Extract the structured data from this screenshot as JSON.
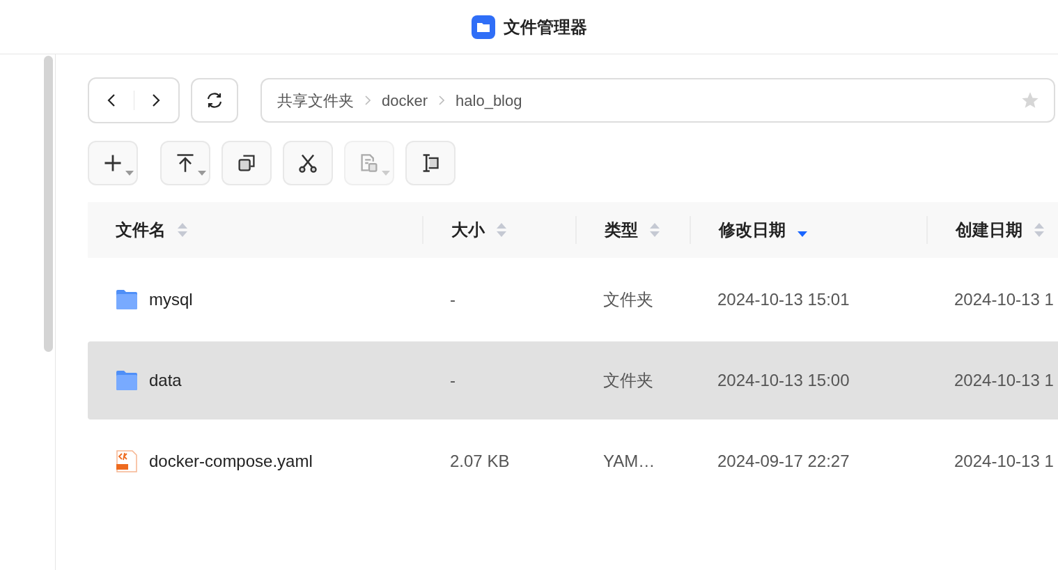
{
  "window": {
    "title": "文件管理器"
  },
  "breadcrumb": [
    "共享文件夹",
    "docker",
    "halo_blog"
  ],
  "favorite": {
    "on": false
  },
  "toolbar": [
    {
      "kind": "new",
      "dropdown": true,
      "disabled": false
    },
    {
      "kind": "upload",
      "dropdown": true,
      "disabled": false
    },
    {
      "kind": "copy",
      "dropdown": false,
      "disabled": false
    },
    {
      "kind": "cut",
      "dropdown": false,
      "disabled": false
    },
    {
      "kind": "paste",
      "dropdown": true,
      "disabled": true
    },
    {
      "kind": "rename",
      "dropdown": false,
      "disabled": false
    }
  ],
  "table": {
    "columns": [
      {
        "label": "文件名",
        "sorted": false
      },
      {
        "label": "大小",
        "sorted": false
      },
      {
        "label": "类型",
        "sorted": false
      },
      {
        "label": "修改日期",
        "sorted": true
      },
      {
        "label": "创建日期",
        "sorted": false
      }
    ],
    "rows": [
      {
        "kind": "folder",
        "name": "mysql",
        "size": "-",
        "type": "文件夹",
        "modified": "2024-10-13 15:01",
        "created": "2024-10-13 1",
        "selected": false
      },
      {
        "kind": "folder",
        "name": "data",
        "size": "-",
        "type": "文件夹",
        "modified": "2024-10-13 15:00",
        "created": "2024-10-13 1",
        "selected": true
      },
      {
        "kind": "yaml",
        "name": "docker-compose.yaml",
        "size": "2.07 KB",
        "type": "YAM…",
        "modified": "2024-09-17 22:27",
        "created": "2024-10-13 1",
        "selected": false
      }
    ]
  }
}
